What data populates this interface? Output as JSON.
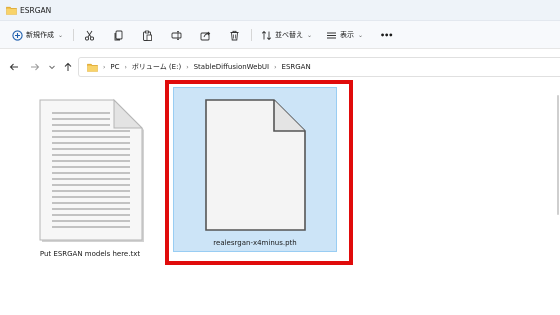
{
  "window": {
    "title": "ESRGAN"
  },
  "toolbar": {
    "new_label": "新規作成",
    "sort_label": "並べ替え",
    "view_label": "表示",
    "more_label": "•••"
  },
  "address": {
    "crumbs": [
      "PC",
      "ボリューム (E:)",
      "StableDiffusionWebUI",
      "ESRGAN"
    ]
  },
  "files": [
    {
      "name": "Put ESRGAN models here.txt",
      "type": "text-file"
    },
    {
      "name": "realesrgan-x4minus.pth",
      "type": "generic-file",
      "selected": true
    }
  ],
  "colors": {
    "selection": "#cce4f7",
    "highlight_box": "#e00b0b",
    "folder": "#f2c14e"
  }
}
